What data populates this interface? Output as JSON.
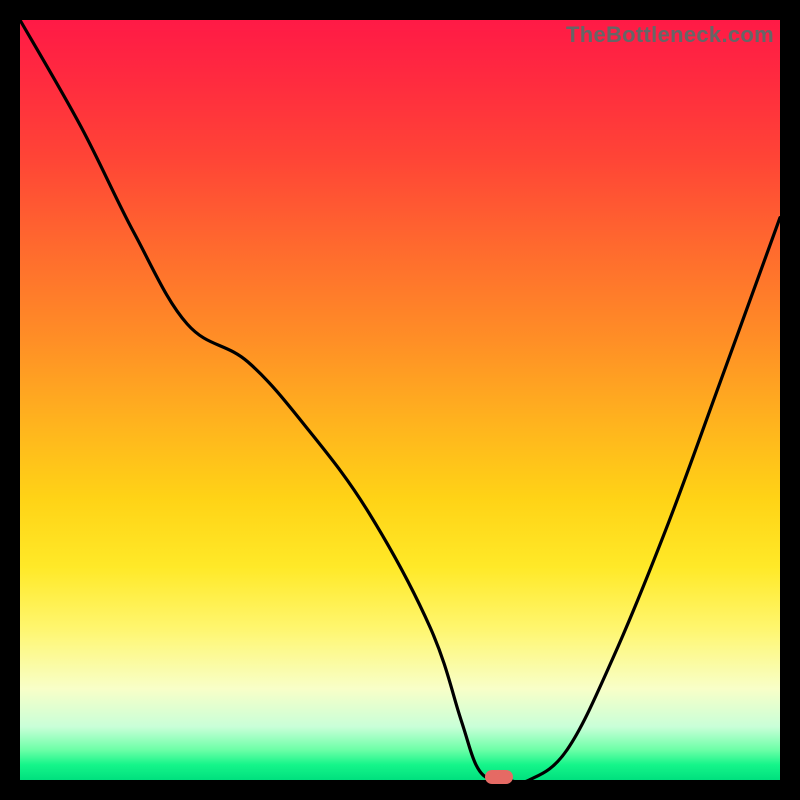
{
  "watermark": "TheBottleneck.com",
  "chart_data": {
    "type": "line",
    "title": "",
    "xlabel": "",
    "ylabel": "",
    "xlim": [
      0,
      100
    ],
    "ylim": [
      0,
      100
    ],
    "x": [
      0,
      8,
      15,
      22,
      30,
      38,
      46,
      54,
      58,
      60,
      62,
      64,
      67,
      72,
      78,
      85,
      92,
      100
    ],
    "values": [
      100,
      86,
      72,
      60,
      55,
      46,
      35,
      20,
      8,
      2,
      0,
      0,
      0,
      4,
      16,
      33,
      52,
      74
    ],
    "marker": {
      "x": 63,
      "y": 0
    },
    "gradient_stops": [
      {
        "pos": 0,
        "color": "#ff1a46"
      },
      {
        "pos": 18,
        "color": "#ff4436"
      },
      {
        "pos": 42,
        "color": "#ff8e26"
      },
      {
        "pos": 63,
        "color": "#ffd316"
      },
      {
        "pos": 80,
        "color": "#fff66e"
      },
      {
        "pos": 93,
        "color": "#c9ffd8"
      },
      {
        "pos": 100,
        "color": "#00e07e"
      }
    ]
  }
}
